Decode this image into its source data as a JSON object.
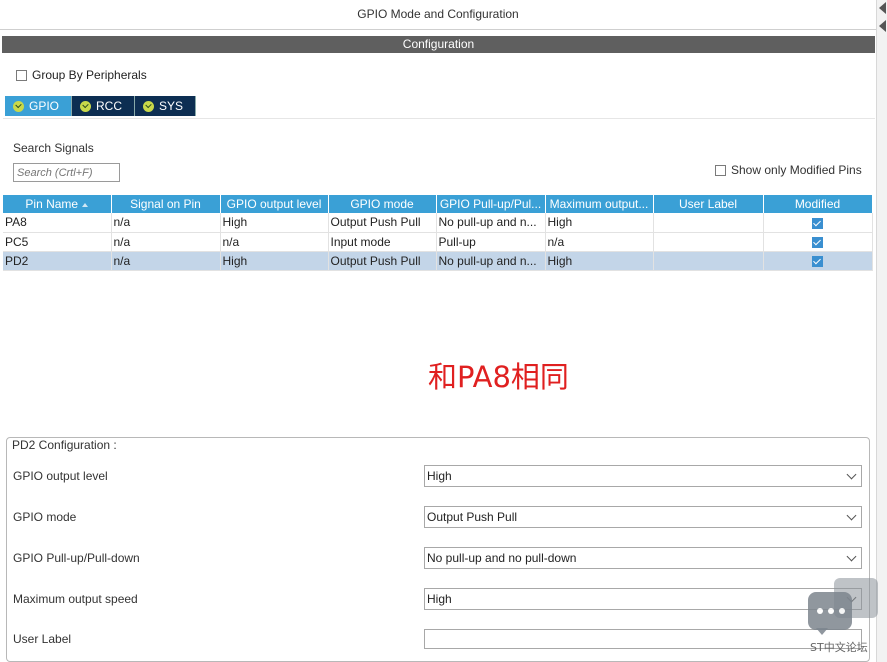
{
  "window": {
    "title": "GPIO Mode and Configuration"
  },
  "config_bar": {
    "label": "Configuration"
  },
  "group_by": {
    "label": "Group By Peripherals",
    "checked": false
  },
  "tabs": [
    {
      "label": "GPIO",
      "active": true
    },
    {
      "label": "RCC",
      "active": false
    },
    {
      "label": "SYS",
      "active": false
    }
  ],
  "search": {
    "label": "Search Signals",
    "placeholder": "Search (Crtl+F)"
  },
  "show_modified": {
    "label": "Show only Modified Pins",
    "checked": false
  },
  "table": {
    "columns": [
      "Pin Name",
      "Signal on Pin",
      "GPIO output level",
      "GPIO mode",
      "GPIO Pull-up/Pul...",
      "Maximum output...",
      "User Label",
      "Modified"
    ],
    "rows": [
      {
        "pin": "PA8",
        "signal": "n/a",
        "level": "High",
        "mode": "Output Push Pull",
        "pull": "No pull-up and n...",
        "speed": "High",
        "label": "",
        "modified": true,
        "selected": false
      },
      {
        "pin": "PC5",
        "signal": "n/a",
        "level": "n/a",
        "mode": "Input mode",
        "pull": "Pull-up",
        "speed": "n/a",
        "label": "",
        "modified": true,
        "selected": false
      },
      {
        "pin": "PD2",
        "signal": "n/a",
        "level": "High",
        "mode": "Output Push Pull",
        "pull": "No pull-up and n...",
        "speed": "High",
        "label": "",
        "modified": true,
        "selected": true
      }
    ]
  },
  "annotation": {
    "text": "和PA8相同",
    "color": "#e02020"
  },
  "pd2_config": {
    "legend": "PD2 Configuration :",
    "fields": [
      {
        "label": "GPIO output level",
        "value": "High",
        "type": "select"
      },
      {
        "label": "GPIO mode",
        "value": "Output Push Pull",
        "type": "select"
      },
      {
        "label": "GPIO Pull-up/Pull-down",
        "value": "No pull-up and no pull-down",
        "type": "select"
      },
      {
        "label": "Maximum output speed",
        "value": "High",
        "type": "select"
      },
      {
        "label": "User Label",
        "value": "",
        "type": "text"
      }
    ]
  },
  "watermark": {
    "text": "ST中文论坛"
  },
  "colors": {
    "accent": "#3aa0d6",
    "tab_inactive": "#0d2e52",
    "selected_row": "#c3d5e8",
    "config_bar": "#5f5f5f"
  }
}
